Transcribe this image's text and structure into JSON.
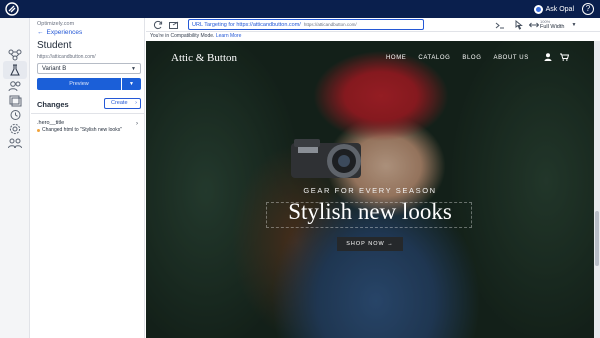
{
  "topbar": {
    "ask_opal": "Ask Opal",
    "help": "?"
  },
  "rail": {
    "icons": [
      "flows-icon",
      "experiment-icon",
      "audiences-icon",
      "pages-icon",
      "history-icon",
      "settings-icon",
      "collaborators-icon"
    ],
    "active": "experiment-icon"
  },
  "panel": {
    "account": "Optimizely.com",
    "back_label": "Experiences",
    "title": "Student",
    "url": "https://atticandbutton.com/",
    "variant": "Variant B",
    "preview_label": "Preview",
    "changes_heading": "Changes",
    "create_label": "Create",
    "change_item": {
      "selector": ".hero__title",
      "description": "Changed html to \"Stylish new looks\""
    }
  },
  "toolbar": {
    "url_targeting": "URL Targeting for https://atticandbutton.com/",
    "current_url": "https://atticandbutton.com/",
    "zoom": "100%",
    "width_mode": "Full Width"
  },
  "compat": {
    "message": "You're in Compatibility Mode.",
    "learn_more": "Learn More"
  },
  "site": {
    "brand": "Attic & Button",
    "nav": [
      "HOME",
      "CATALOG",
      "BLOG",
      "ABOUT US"
    ],
    "tagline": "GEAR FOR EVERY SEASON",
    "headline": "Stylish new looks",
    "cta": "SHOP NOW →"
  },
  "colors": {
    "topbar": "#0a1f4d",
    "accent": "#1b5fd8",
    "hat": "#c9232d"
  }
}
